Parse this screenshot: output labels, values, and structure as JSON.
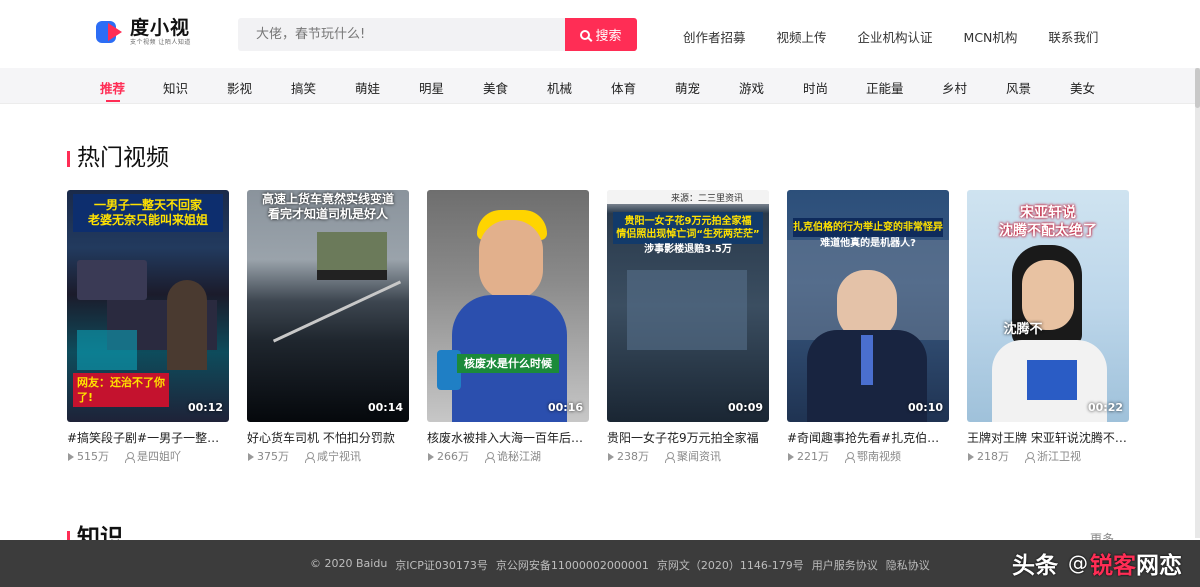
{
  "brand": {
    "name": "度小视",
    "slogan": "支个视频  让陌人知道",
    "accent": "#ff2d55",
    "blue": "#2c6df5"
  },
  "search": {
    "placeholder": "大佬，春节玩什么!",
    "button_label": "搜索"
  },
  "top_links": [
    "创作者招募",
    "视频上传",
    "企业机构认证",
    "MCN机构",
    "联系我们"
  ],
  "categories": {
    "active": "推荐",
    "items": [
      "推荐",
      "知识",
      "影视",
      "搞笑",
      "萌娃",
      "明星",
      "美食",
      "机械",
      "体育",
      "萌宠",
      "游戏",
      "时尚",
      "正能量",
      "乡村",
      "风景",
      "美女"
    ]
  },
  "sections": {
    "hot": {
      "title": "热门视频"
    },
    "knowledge": {
      "title": "知识",
      "more": "更多"
    }
  },
  "videos": [
    {
      "title": "#搞笑段子剧#一男子一整天不回家老婆无奈只能叫来姐姐",
      "views": "515万",
      "author": "是四姐吖",
      "duration": "00:12",
      "caption_top": "一男子一整天不回家\n老婆无奈只能叫来姐姐",
      "caption_bottom": "网友：还治不了你了!"
    },
    {
      "title": "好心货车司机 不怕扣分罚款",
      "views": "375万",
      "author": "咸宁视讯",
      "duration": "00:14",
      "caption_top": "高速上货车竟然实线变道\n看完才知道司机是好人",
      "caption_bottom": ""
    },
    {
      "title": "核废水被排入大海一百年后会怎样",
      "views": "266万",
      "author": "诡秘江湖",
      "duration": "00:16",
      "caption_top": "",
      "caption_bottom": "核废水是什么时候"
    },
    {
      "title": "贵阳一女子花9万元拍全家福",
      "views": "238万",
      "author": "聚闻资讯",
      "duration": "00:09",
      "caption_top": "贵阳一女子花9万元拍全家福\n情侣照出现悼亡词“生死两茫茫”",
      "caption_bottom": "涉事影楼退赔3.5万",
      "source": "来源：二三里资讯"
    },
    {
      "title": "#奇闻趣事抢先看#扎克伯格的行为举止变的非常怪异",
      "views": "221万",
      "author": "鄂南视频",
      "duration": "00:10",
      "caption_top": "扎克伯格的行为举止变的非常怪异",
      "caption_bottom": "难道他真的是机器人?"
    },
    {
      "title": "王牌对王牌 宋亚轩说沈腾不配太绝了",
      "views": "218万",
      "author": "浙江卫视",
      "duration": "00:22",
      "caption_top": "宋亚轩说\n沈腾不配太绝了",
      "caption_bottom": "沈腾不"
    }
  ],
  "footer": {
    "items": [
      "© 2020 Baidu",
      "京ICP证030173号",
      "京公网安备11000002000001",
      "京网文（2020）1146-179号",
      "用户服务协议",
      "隐私协议"
    ],
    "watermark_left": "头条",
    "watermark_at": "@",
    "watermark_red": "锐客",
    "watermark_right": "网恋"
  }
}
